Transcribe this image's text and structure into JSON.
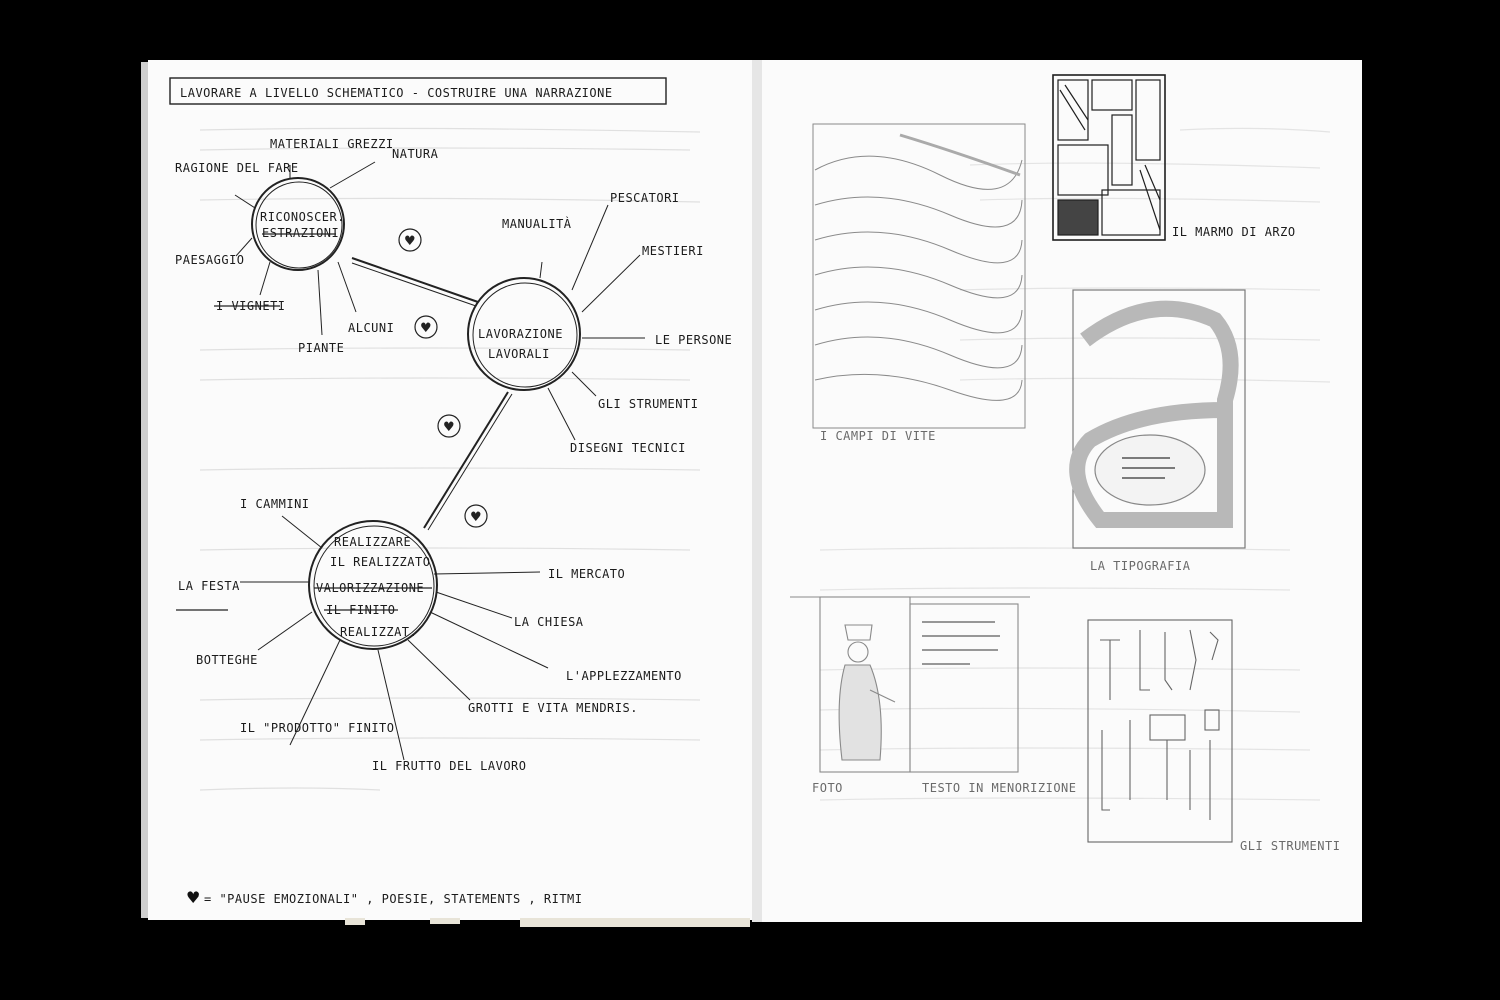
{
  "left_page": {
    "header": "LAVORARE A LIVELLO SCHEMATICO - COSTRUIRE UNA NARRAZIONE",
    "hub_1": {
      "label_top": "RICONOSCER.",
      "label_bottom": "ESTRAZIONI",
      "spokes": [
        "MATERIALI GREZZI",
        "NATURA",
        "RAGIONE DEL FARE",
        "PAESAGGIO",
        "I VIGNETI",
        "PIANTE",
        "ALCUNI"
      ]
    },
    "hub_2": {
      "label_top": "LAVORAZIONE",
      "label_bottom": "LAVORALI",
      "spokes": [
        "MANUALITÀ",
        "PESCATORI",
        "MESTIERI",
        "LE PERSONE",
        "GLI STRUMENTI",
        "DISEGNI TECNICI"
      ]
    },
    "hub_3": {
      "label_1": "REALIZZARE",
      "label_2": "IL REALIZZATO",
      "label_3": "VALORIZZAZIONE",
      "label_4": "IL FINITO",
      "label_5": "REALIZZAT.",
      "spokes": [
        "I CAMMINI",
        "LA FESTA",
        "BOTTEGHE",
        "IL \"PRODOTTO\" FINITO",
        "IL FRUTTO DEL LAVORO",
        "GROTTI E VITA MENDRIS.",
        "L'APPLEZZAMENTO",
        "LA CHIESA",
        "IL MERCATO"
      ]
    },
    "legend": "= \"PAUSE EMOZIONALI\" , POESIE, STATEMENTS , RITMI"
  },
  "right_page": {
    "captions": {
      "fields": "I CAMPI DI VITE",
      "marble": "IL MARMO DI ARZO",
      "typography": "LA TIPOGRAFIA",
      "photo": "FOTO",
      "text": "TESTO IN MENORIZIONE",
      "tools": "GLI STRUMENTI"
    }
  }
}
